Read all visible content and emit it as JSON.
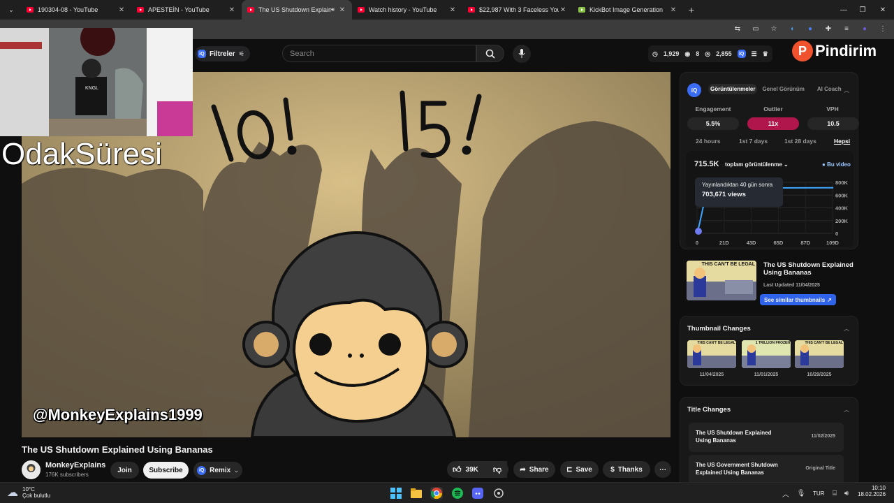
{
  "browser": {
    "tabs": [
      {
        "title": "190304-08 - YouTube",
        "active": false,
        "audio": false
      },
      {
        "title": "APESTEİN - YouTube",
        "active": false,
        "audio": false
      },
      {
        "title": "The US Shutdown Explained",
        "active": true,
        "audio": true
      },
      {
        "title": "Watch history - YouTube",
        "active": false,
        "audio": false
      },
      {
        "title": "$22,987 With 3 Faceless YouTub",
        "active": false,
        "audio": false
      },
      {
        "title": "KickBot Image Generation",
        "active": false,
        "audio": false
      }
    ],
    "new_tab": "+"
  },
  "youtube": {
    "filter_label": "Filtreler",
    "search_placeholder": "Search",
    "stats": {
      "views": "1,929",
      "watching": "8",
      "eye": "2,855"
    },
    "create_label": "+"
  },
  "overlay": {
    "brand": "Pindirim",
    "focus_text": "OdakSüresi"
  },
  "video": {
    "watermark": "@MonkeyExplains1999",
    "numbers": [
      "10!",
      "15!"
    ],
    "title": "The US Shutdown Explained Using Bananas",
    "channel": "MonkeyExplains",
    "subscribers": "176K subscribers",
    "join": "Join",
    "subscribe": "Subscribe",
    "remix": "Remix",
    "likes": "39K",
    "share": "Share",
    "save": "Save",
    "thanks": "Thanks"
  },
  "panel": {
    "tabs": [
      "Görüntülenmeler",
      "Genel Görünüm",
      "AI Coach"
    ],
    "metrics": [
      {
        "label": "Engagement",
        "value": "5.5%"
      },
      {
        "label": "Outlier",
        "value": "11x"
      },
      {
        "label": "VPH",
        "value": "10.5"
      }
    ],
    "ranges": [
      "24 hours",
      "1st 7 days",
      "1st 28 days",
      "Hepsi"
    ],
    "total": "715.5K",
    "total_dropdown": "toplam görüntülenme",
    "legend": "Bu video",
    "tooltip_title": "Yayınlandıktan 40 gün sonra",
    "tooltip_value": "703,671 views",
    "video_title": "The US Shutdown Explained Using Bananas",
    "last_updated": "Last Updated 11/04/2025",
    "similar_btn": "See similar thumbnails",
    "thumb_text": "THIS CAN'T BE LEGAL",
    "thumb_changes_title": "Thumbnail Changes",
    "thumb_changes": [
      {
        "caption": "THIS CAN'T BE LEGAL",
        "date": "11/04/2025"
      },
      {
        "caption": "1 TRILLION FROZEN",
        "date": "11/01/2025"
      },
      {
        "caption": "THIS CAN'T BE LEGAL",
        "date": "10/29/2025"
      }
    ],
    "title_changes_title": "Title Changes",
    "title_changes": [
      {
        "title": "The US Shutdown Explained Using Bananas",
        "date": "11/02/2025"
      },
      {
        "title": "The US Government Shutdown Explained Using Bananas",
        "date": "Original Title"
      }
    ]
  },
  "chart_data": {
    "type": "line",
    "x": [
      0,
      2,
      5,
      10,
      15,
      21,
      30,
      40,
      60,
      109
    ],
    "series": [
      {
        "values": [
          0,
          150000,
          420000,
          580000,
          640000,
          670000,
          690000,
          703671,
          712000,
          715500
        ]
      }
    ],
    "x_ticks": [
      "0",
      "21D",
      "43D",
      "65D",
      "87D",
      "109D"
    ],
    "y_ticks": [
      "800K",
      "600K",
      "400K",
      "200K",
      "0"
    ],
    "ylim": [
      0,
      800000
    ],
    "xlim": [
      0,
      109
    ],
    "color": "#3ea6ff"
  },
  "taskbar": {
    "weather_temp": "10°C",
    "weather_desc": "Çok bulutlu",
    "lang": "TUR",
    "time": "10:10",
    "date": "18.02.2026"
  }
}
